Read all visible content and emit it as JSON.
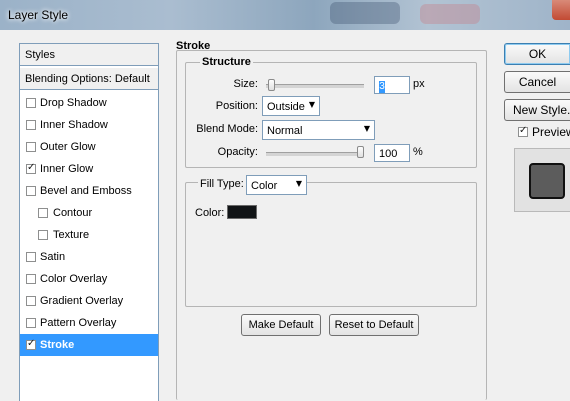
{
  "window": {
    "title": "Layer Style"
  },
  "styles_panel": {
    "header": "Styles",
    "blending_options": "Blending Options: Default",
    "items": [
      {
        "label": "Drop Shadow",
        "checked": false,
        "indent": false,
        "selected": false
      },
      {
        "label": "Inner Shadow",
        "checked": false,
        "indent": false,
        "selected": false
      },
      {
        "label": "Outer Glow",
        "checked": false,
        "indent": false,
        "selected": false
      },
      {
        "label": "Inner Glow",
        "checked": true,
        "indent": false,
        "selected": false
      },
      {
        "label": "Bevel and Emboss",
        "checked": false,
        "indent": false,
        "selected": false
      },
      {
        "label": "Contour",
        "checked": false,
        "indent": true,
        "selected": false
      },
      {
        "label": "Texture",
        "checked": false,
        "indent": true,
        "selected": false
      },
      {
        "label": "Satin",
        "checked": false,
        "indent": false,
        "selected": false
      },
      {
        "label": "Color Overlay",
        "checked": false,
        "indent": false,
        "selected": false
      },
      {
        "label": "Gradient Overlay",
        "checked": false,
        "indent": false,
        "selected": false
      },
      {
        "label": "Pattern Overlay",
        "checked": false,
        "indent": false,
        "selected": false
      },
      {
        "label": "Stroke",
        "checked": true,
        "indent": false,
        "selected": true
      }
    ]
  },
  "stroke": {
    "section_title": "Stroke",
    "structure": {
      "title": "Structure",
      "size_label": "Size:",
      "size_value": "3",
      "size_unit": "px",
      "size_slider_fraction": 0.02,
      "position_label": "Position:",
      "position_value": "Outside",
      "blend_mode_label": "Blend Mode:",
      "blend_mode_value": "Normal",
      "opacity_label": "Opacity:",
      "opacity_value": "100",
      "opacity_unit": "%",
      "opacity_slider_fraction": 1.0
    },
    "fill": {
      "fill_type_label": "Fill Type:",
      "fill_type_value": "Color",
      "color_label": "Color:",
      "color_value": "#111416"
    },
    "make_default": "Make Default",
    "reset_to_default": "Reset to Default"
  },
  "actions": {
    "ok": "OK",
    "cancel": "Cancel",
    "new_style": "New Style...",
    "preview_label": "Preview",
    "preview_checked": true
  },
  "colors": {
    "selection": "#3399ff",
    "border": "#7f9db9",
    "dialog_bg": "#f0f0f0"
  }
}
